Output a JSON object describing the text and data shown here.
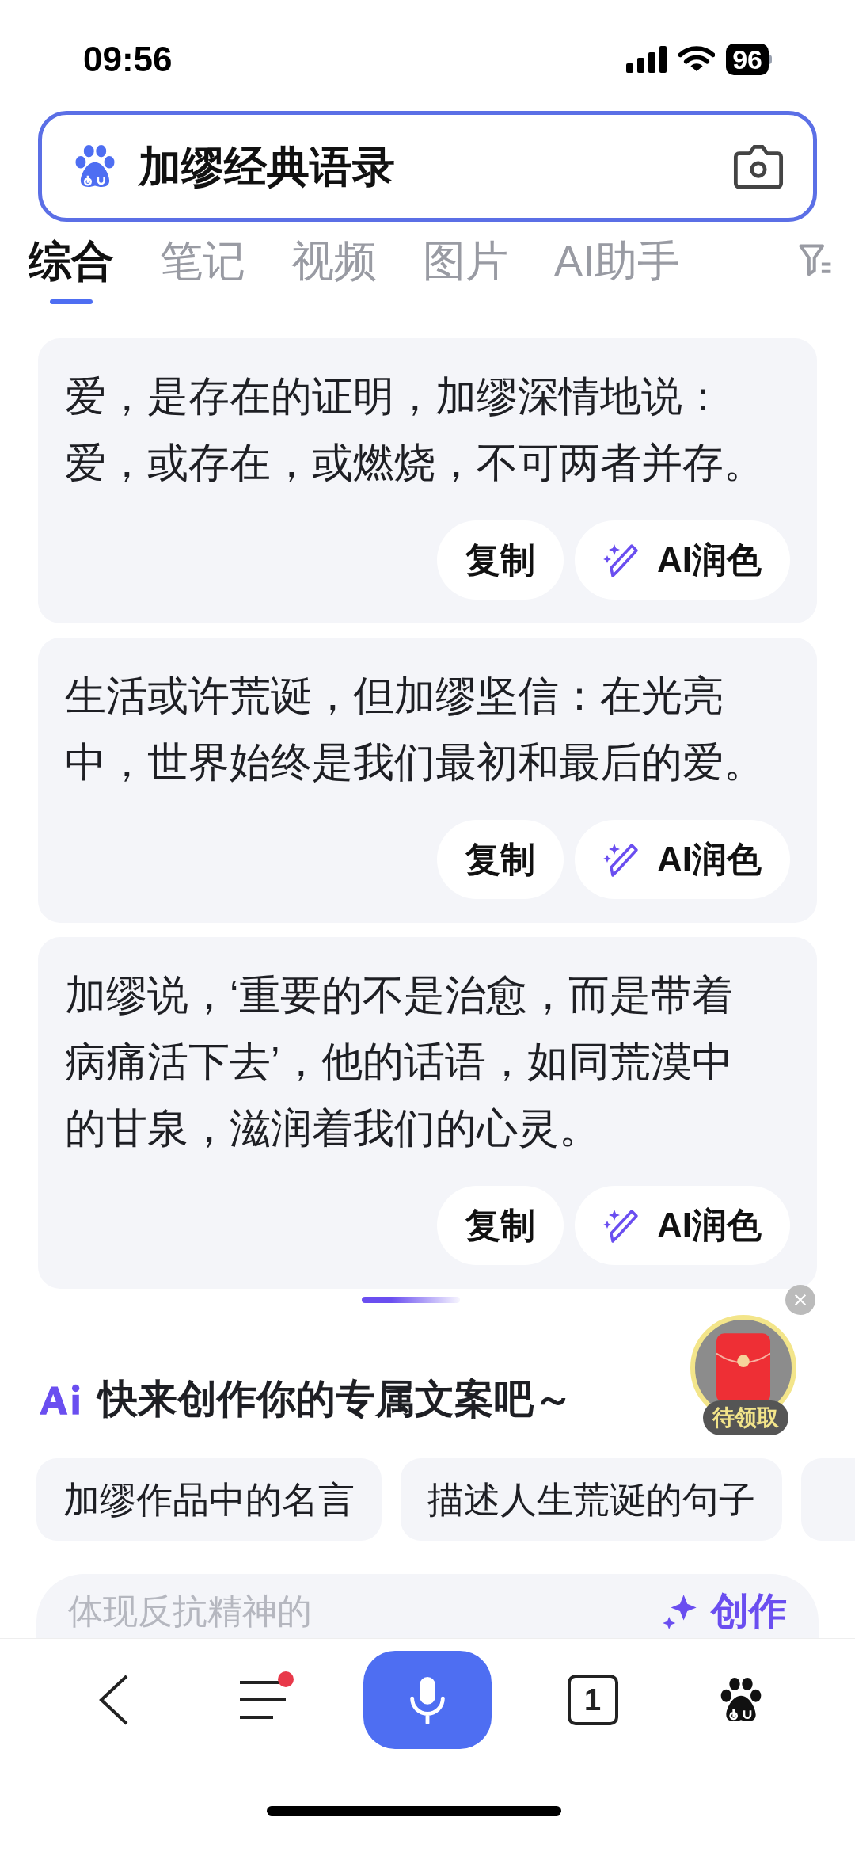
{
  "status_bar": {
    "time": "09:56",
    "battery": "96"
  },
  "search": {
    "query": "加缪经典语录"
  },
  "tabs": [
    {
      "label": "综合",
      "selected": true
    },
    {
      "label": "笔记",
      "selected": false
    },
    {
      "label": "视频",
      "selected": false
    },
    {
      "label": "图片",
      "selected": false
    },
    {
      "label": "AI助手",
      "selected": false
    }
  ],
  "results": [
    {
      "lines": [
        "爱，是存在的证明，加缪深情地说：",
        "爱，或存在，或燃烧，不可两者并存。"
      ],
      "copy": "复制",
      "polish": "AI润色"
    },
    {
      "lines": [
        "生活或许荒诞，但加缪坚信：在光亮",
        "中，世界始终是我们最初和最后的爱。"
      ],
      "copy": "复制",
      "polish": "AI润色"
    },
    {
      "lines": [
        "加缪说，‘重要的不是治愈，而是带着",
        "病痛活下去’，他的话语，如同荒漠中",
        "的甘泉，滋润着我们的心灵。"
      ],
      "copy": "复制",
      "polish": "AI润色"
    }
  ],
  "red_packet": {
    "label": "待领取"
  },
  "ai_section": {
    "title": "快来创作你的专属文案吧～",
    "chips": [
      "加缪作品中的名言",
      "描述人生荒诞的句子"
    ],
    "input": {
      "placeholder": "体现反抗精神的",
      "button": "创作"
    }
  },
  "bottom_nav": {
    "tab_count": "1",
    "menu_badge": true
  }
}
